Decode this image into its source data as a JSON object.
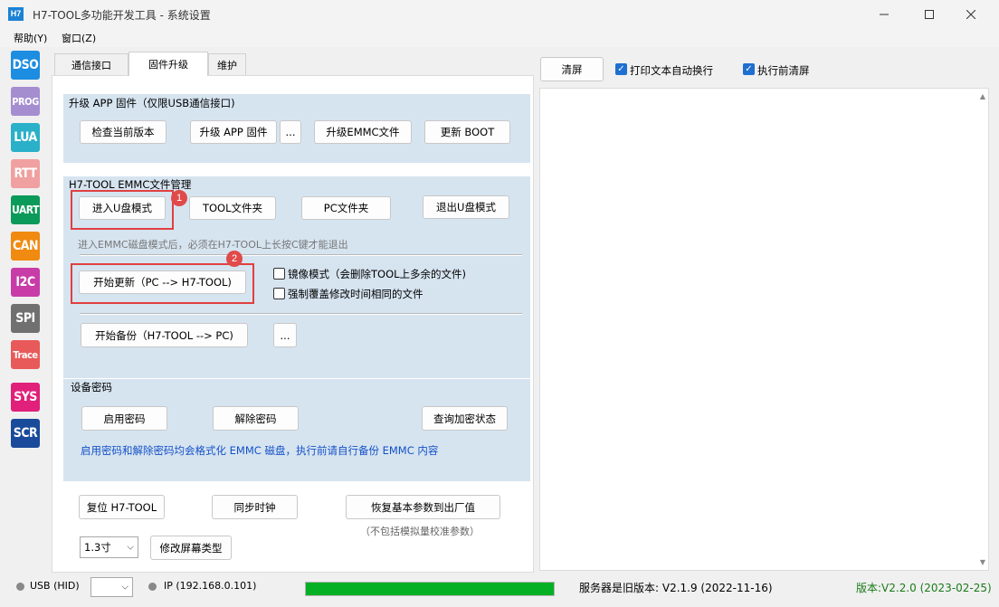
{
  "window": {
    "icon_text": "H7",
    "title": "H7-TOOL多功能开发工具 - 系统设置"
  },
  "menu": [
    "帮助(Y)",
    "窗口(Z)"
  ],
  "sidebar": [
    {
      "label": "DSO",
      "color": "#1c8de0"
    },
    {
      "label": "PROG",
      "color": "#a58ed0"
    },
    {
      "label": "LUA",
      "color": "#2ab0c8"
    },
    {
      "label": "RTT",
      "color": "#f0a0a0"
    },
    {
      "label": "UART",
      "color": "#0c9a5a"
    },
    {
      "label": "CAN",
      "color": "#f08a10"
    },
    {
      "label": "I2C",
      "color": "#c83ca8"
    },
    {
      "label": "SPI",
      "color": "#707070"
    },
    {
      "label": "Trace",
      "color": "#e85a5a"
    },
    {
      "label": "SYS",
      "color": "#e0207a"
    },
    {
      "label": "SCR",
      "color": "#1a4a9a"
    }
  ],
  "tabs": [
    "通信接口",
    "固件升级",
    "维护"
  ],
  "upgrade_group": {
    "title": "升级 APP 固件（仅限USB通信接口)",
    "check_version": "检查当前版本",
    "upgrade_app": "升级 APP 固件",
    "browse": "...",
    "upgrade_emmc": "升级EMMC文件",
    "update_boot": "更新 BOOT"
  },
  "emmc_group": {
    "title": "H7-TOOL EMMC文件管理",
    "enter_udisk": "进入U盘模式",
    "tool_folder": "TOOL文件夹",
    "pc_folder": "PC文件夹",
    "exit_udisk": "退出U盘模式",
    "hint": "进入EMMC磁盘模式后，必须在H7-TOOL上长按C键才能退出",
    "start_update": "开始更新（PC --> H7-TOOL)",
    "mirror_mode": "镜像模式（会删除TOOL上多余的文件)",
    "force_overwrite": "强制覆盖修改时间相同的文件",
    "start_backup": "开始备份（H7-TOOL --> PC)",
    "browse": "...",
    "badge1": "1",
    "badge2": "2"
  },
  "password_group": {
    "title": "设备密码",
    "enable": "启用密码",
    "disable": "解除密码",
    "query": "查询加密状态",
    "note": "启用密码和解除密码均会格式化 EMMC 磁盘，执行前请自行备份 EMMC 内容"
  },
  "bottom": {
    "reset": "复位 H7-TOOL",
    "sync_clock": "同步时钟",
    "restore": "恢复基本参数到出厂值",
    "restore_note": "（不包括模拟量校准参数）",
    "screen_size": "1.3寸",
    "change_screen": "修改屏幕类型"
  },
  "right_panel": {
    "clear": "清屏",
    "auto_wrap": "打印文本自动换行",
    "clear_before": "执行前清屏",
    "auto_wrap_checked": true,
    "clear_before_checked": true
  },
  "status": {
    "usb": "USB (HID)",
    "ip": "IP (192.168.0.101)",
    "server": "服务器是旧版本: V2.1.9 (2022-11-16)",
    "version": "版本:V2.2.0 (2023-02-25)",
    "progress": 1.0,
    "progress_color": "#06b025",
    "version_color": "#1a7a1a"
  }
}
